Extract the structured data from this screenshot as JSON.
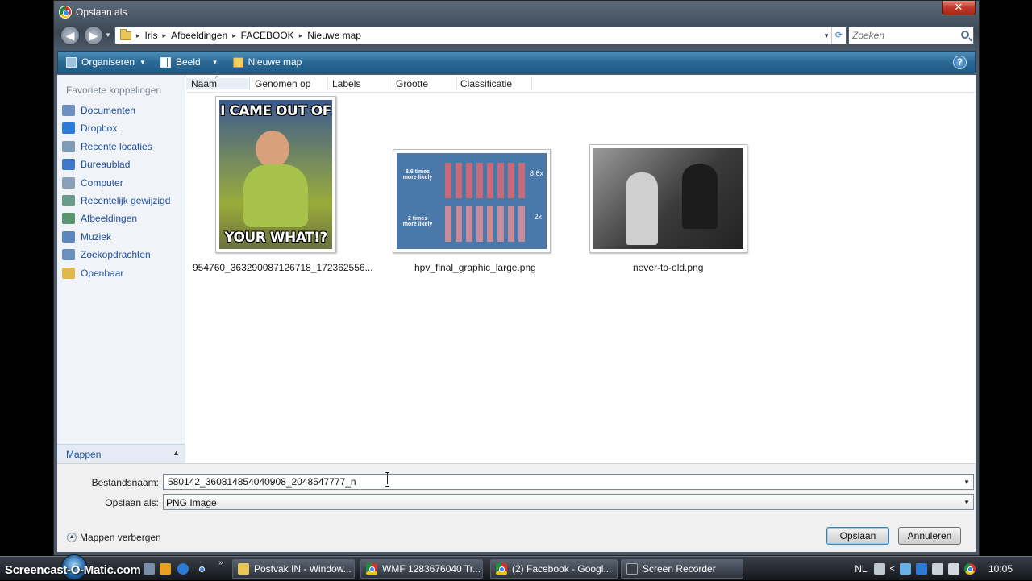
{
  "window": {
    "title": "Opslaan als",
    "close_glyph": "✕"
  },
  "address": {
    "crumbs": [
      "Iris",
      "Afbeeldingen",
      "FACEBOOK",
      "Nieuwe map"
    ],
    "search_placeholder": "Zoeken"
  },
  "toolbar": {
    "organize": "Organiseren",
    "view": "Beeld",
    "new_folder": "Nieuwe map",
    "help": "?"
  },
  "sidebar": {
    "heading": "Favoriete koppelingen",
    "items": [
      {
        "label": "Documenten",
        "color": "#6d8fbd"
      },
      {
        "label": "Dropbox",
        "color": "#2b7bd6"
      },
      {
        "label": "Recente locaties",
        "color": "#7f9bb5"
      },
      {
        "label": "Bureaublad",
        "color": "#3d78c9"
      },
      {
        "label": "Computer",
        "color": "#8aa0b8"
      },
      {
        "label": "Recentelijk gewijzigd",
        "color": "#6a9b8a"
      },
      {
        "label": "Afbeeldingen",
        "color": "#5a9470"
      },
      {
        "label": "Muziek",
        "color": "#5c86c0"
      },
      {
        "label": "Zoekopdrachten",
        "color": "#6d8fbd"
      },
      {
        "label": "Openbaar",
        "color": "#e0b94a"
      }
    ],
    "folders_toggle": "Mappen"
  },
  "columns": [
    "Naam",
    "Genomen op",
    "Labels",
    "Grootte",
    "Classificatie"
  ],
  "files": [
    {
      "name": "954760_363290087126718_172362556...",
      "thumb_top": "I CAME OUT OF",
      "thumb_bottom": "YOUR WHAT!?"
    },
    {
      "name": "hpv_final_graphic_large.png",
      "thumb_line1": "8.6 times more likely",
      "thumb_line2": "2 times more likely",
      "thumb_val1": "8.6x",
      "thumb_val2": "2x"
    },
    {
      "name": "never-to-old.png"
    }
  ],
  "form": {
    "filename_label": "Bestandsnaam:",
    "filename_value": "580142_360814854040908_2048547777_n",
    "type_label": "Opslaan als:",
    "type_value": "PNG Image",
    "hide_folders": "Mappen verbergen",
    "save": "Opslaan",
    "cancel": "Annuleren"
  },
  "taskbar": {
    "watermark": "Screencast-O-Matic.com",
    "tasks": [
      "Postvak IN - Window...",
      "WMF 1283676040 Tr...",
      "(2) Facebook - Googl...",
      "Screen Recorder"
    ],
    "more": "»",
    "lang": "NL",
    "clock": "10:05"
  }
}
